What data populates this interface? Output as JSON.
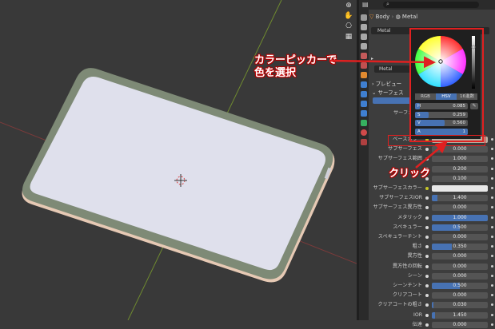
{
  "panel": {
    "search_icon": "search-icon",
    "breadcrumb_object": "Body",
    "breadcrumb_material": "Metal",
    "material_slot": "Metal",
    "material_name": "Metal",
    "preview_label": "プレビュー",
    "surface_label": "サーフェス",
    "surface_prefix": "サーフェ"
  },
  "picker": {
    "tabs": [
      "RGB",
      "HSV",
      "16進数"
    ],
    "active_tab": "HSV",
    "fields": [
      {
        "label": "H",
        "value": "0.085",
        "fraction": 0.085
      },
      {
        "label": "S",
        "value": "0.259",
        "fraction": 0.259
      },
      {
        "label": "V",
        "value": "0.560",
        "fraction": 0.56
      },
      {
        "label": "A",
        "value": "1",
        "fraction": 1
      }
    ]
  },
  "properties": [
    {
      "label": "ベースカラー",
      "type": "color",
      "color": "#b9ad9f"
    },
    {
      "label": "サブサーフェス",
      "value": "0.000",
      "fraction": 0
    },
    {
      "label": "サブサーフェス範囲",
      "value": "1.000",
      "fraction": 0
    },
    {
      "label": "",
      "value": "0.200",
      "fraction": 0
    },
    {
      "label": "",
      "value": "0.100",
      "fraction": 0
    },
    {
      "label": "サブサーフェスカラー",
      "type": "color",
      "color": "#e8e8e8"
    },
    {
      "label": "サブサーフェスIOR",
      "value": "1.400",
      "fraction": 0.1
    },
    {
      "label": "サブサーフェス異方性",
      "value": "0.000",
      "fraction": 0
    },
    {
      "label": "メタリック",
      "value": "1.000",
      "fraction": 1
    },
    {
      "label": "スペキュラー",
      "value": "0.500",
      "fraction": 0.5
    },
    {
      "label": "スペキュラーチント",
      "value": "0.000",
      "fraction": 0
    },
    {
      "label": "粗さ",
      "value": "0.350",
      "fraction": 0.35
    },
    {
      "label": "異方性",
      "value": "0.000",
      "fraction": 0
    },
    {
      "label": "異方性の回転",
      "value": "0.000",
      "fraction": 0
    },
    {
      "label": "シーン",
      "value": "0.000",
      "fraction": 0
    },
    {
      "label": "シーンチント",
      "value": "0.500",
      "fraction": 0.5
    },
    {
      "label": "クリアコート",
      "value": "0.000",
      "fraction": 0
    },
    {
      "label": "クリアコートの粗さ",
      "value": "0.030",
      "fraction": 0.03
    },
    {
      "label": "IOR",
      "value": "1.450",
      "fraction": 0.05
    },
    {
      "label": "伝達",
      "value": "0.000",
      "fraction": 0
    }
  ],
  "annotations": {
    "picker_line1": "カラーピッカーで",
    "picker_line2": "色を選択",
    "click_label": "クリック",
    "color": "#e02020"
  },
  "viewport_tools": [
    "zoom-icon",
    "hand-icon",
    "camera-icon",
    "grid-icon"
  ]
}
